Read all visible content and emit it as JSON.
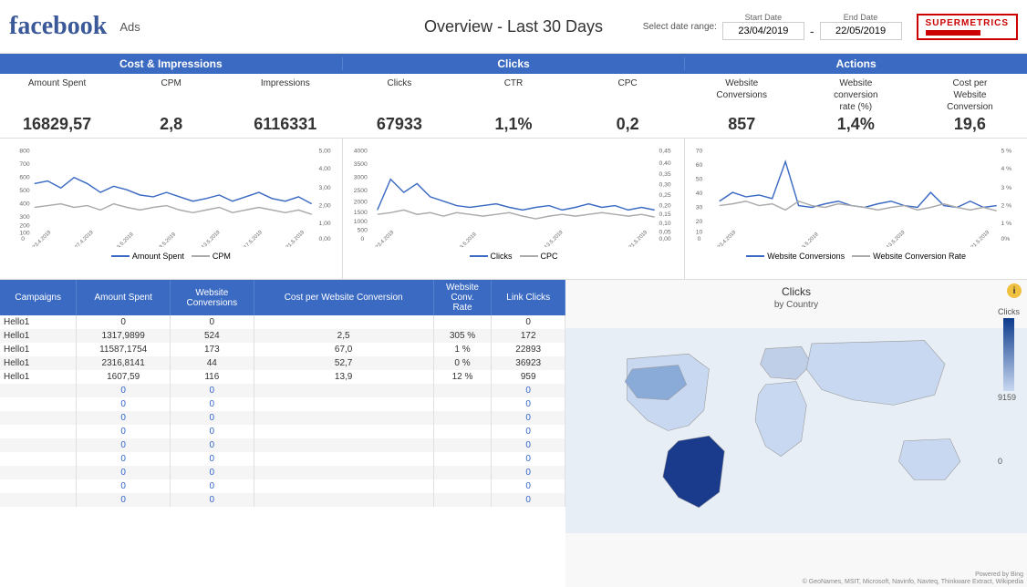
{
  "header": {
    "logo": "facebook",
    "ads_label": "Ads",
    "title": "Overview - Last 30 Days",
    "select_label": "Select date range:",
    "start_date_label": "Start Date",
    "end_date_label": "End Date",
    "start_date": "23/04/2019",
    "end_date": "22/05/2019",
    "supermetrics": "SUPERMETRICS"
  },
  "sections": {
    "cost_impressions": "Cost & Impressions",
    "clicks": "Clicks",
    "actions": "Actions"
  },
  "metrics": {
    "amount_spent_label": "Amount Spent",
    "cpm_label": "CPM",
    "impressions_label": "Impressions",
    "clicks_label": "Clicks",
    "ctr_label": "CTR",
    "cpc_label": "CPC",
    "website_conv_label": "Website\nConversions",
    "conv_rate_label": "Website\nconversion\nrate (%)",
    "cost_per_conv_label": "Cost per\nWebsite\nConversion",
    "amount_spent_val": "16829,57",
    "cpm_val": "2,8",
    "impressions_val": "6116331",
    "clicks_val": "67933",
    "ctr_val": "1,1%",
    "cpc_val": "0,2",
    "website_conv_val": "857",
    "conv_rate_val": "1,4%",
    "cost_per_conv_val": "19,6"
  },
  "charts": {
    "chart1_legend": [
      "Amount Spent",
      "CPM"
    ],
    "chart2_legend": [
      "Clicks",
      "CPC"
    ],
    "chart3_legend": [
      "Website Conversions",
      "Website Conversion Rate"
    ]
  },
  "table": {
    "headers": [
      "Campaigns",
      "Amount Spent",
      "Website\nConversions",
      "Cost per Website Conversion",
      "Website\nConv.\nRate",
      "Link Clicks"
    ],
    "rows": [
      [
        "Hello1",
        "0",
        "0",
        "",
        "",
        "0"
      ],
      [
        "Hello1",
        "1317,9899",
        "524",
        "2,5",
        "305 %",
        "172"
      ],
      [
        "Hello1",
        "11587,1754",
        "173",
        "67,0",
        "1 %",
        "22893"
      ],
      [
        "Hello1",
        "2316,8141",
        "44",
        "52,7",
        "0 %",
        "36923"
      ],
      [
        "Hello1",
        "1607,59",
        "116",
        "13,9",
        "12 %",
        "959"
      ],
      [
        "",
        "0",
        "0",
        "",
        "",
        "0"
      ],
      [
        "",
        "0",
        "0",
        "",
        "",
        "0"
      ],
      [
        "",
        "0",
        "0",
        "",
        "",
        "0"
      ],
      [
        "",
        "0",
        "0",
        "",
        "",
        "0"
      ],
      [
        "",
        "0",
        "0",
        "",
        "",
        "0"
      ],
      [
        "",
        "0",
        "0",
        "",
        "",
        "0"
      ],
      [
        "",
        "0",
        "0",
        "",
        "",
        "0"
      ],
      [
        "",
        "0",
        "0",
        "",
        "",
        "0"
      ],
      [
        "",
        "0",
        "0",
        "",
        "",
        "0"
      ]
    ]
  },
  "map": {
    "title": "Clicks",
    "subtitle": "by Country",
    "legend_max": "9159",
    "legend_min": "0",
    "legend_label": "Clicks",
    "powered": "Powered by Bing",
    "credit": "© GeoNames, MSIT, Microsoft, Navinfo, Navteq, Thinkware Extract, Wikipedia"
  }
}
